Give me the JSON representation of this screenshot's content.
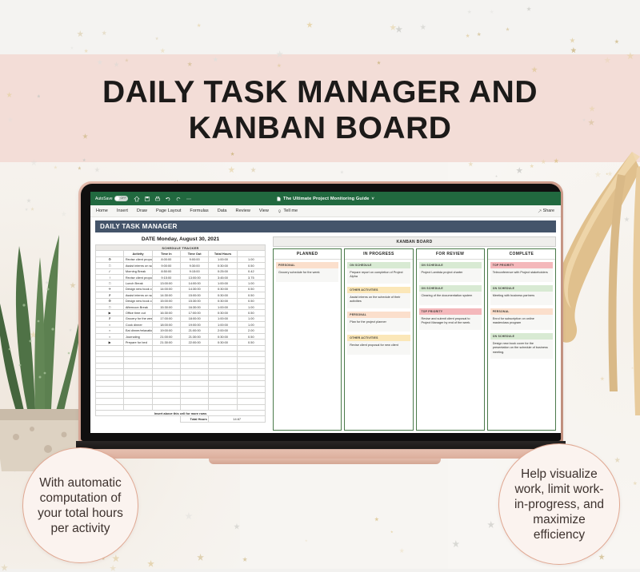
{
  "poster": {
    "title_line1": "DAILY TASK MANAGER AND",
    "title_line2": "KANBAN BOARD",
    "callout_left": "With automatic computation of your total hours per activity",
    "callout_right": "Help visualize work, limit work-in-progress, and maximize efficiency",
    "accent_pink": "#f3ddd7",
    "accent_rose": "#e0a892",
    "excel_green": "#21693f",
    "banner_navy": "#44546a"
  },
  "excel": {
    "autosave_label": "AutoSave",
    "autosave_state": "OFF",
    "document_title": "The Ultimate Project Monitoring Guide",
    "title_chevron": "˅",
    "quick_icons": [
      "home-icon",
      "save-icon",
      "print-icon",
      "undo-icon",
      "redo-icon",
      "more-icon"
    ],
    "ribbon_tabs": [
      "Home",
      "Insert",
      "Draw",
      "Page Layout",
      "Formulas",
      "Data",
      "Review",
      "View"
    ],
    "tell_me": "Tell me",
    "share_label": "Share"
  },
  "sheet": {
    "banner": "DAILY TASK MANAGER",
    "date_label": "DATE",
    "date_value": "Monday, August 30, 2021",
    "tracker_title": "SCHEDULE TRACKER",
    "columns": [
      "",
      "Activity",
      "Time In",
      "Time Out",
      "Total Hours",
      ""
    ],
    "rows": [
      {
        "icon": "⚙",
        "activity": "Revise client proposal for new client",
        "time_in": "8:00:00",
        "time_out": "9:00:00",
        "dur": "1:00:00",
        "hours": "1.00"
      },
      {
        "icon": "□",
        "activity": "Assist interns on schedule of activities",
        "time_in": "9:00:00",
        "time_out": "9:30:00",
        "dur": "0:30:00",
        "hours": "0.50"
      },
      {
        "icon": "✓",
        "activity": "Morning Break",
        "time_in": "8:50:00",
        "time_out": "9:15:00",
        "dur": "0:25:00",
        "hours": "0.42"
      },
      {
        "icon": "!",
        "activity": "Revise client proposal for new client",
        "time_in": "9:15:00",
        "time_out": "13:00:00",
        "dur": "3:45:00",
        "hours": "3.75"
      },
      {
        "icon": "□",
        "activity": "Lunch Break",
        "time_in": "13:00:00",
        "time_out": "14:00:00",
        "dur": "1:00:00",
        "hours": "1.00"
      },
      {
        "icon": "✈",
        "activity": "Design new book cover",
        "time_in": "14:00:00",
        "time_out": "14:30:00",
        "dur": "0:30:00",
        "hours": "0.50"
      },
      {
        "icon": "✗",
        "activity": "Assist interns on schedule of activities",
        "time_in": "14:30:00",
        "time_out": "15:00:00",
        "dur": "0:30:00",
        "hours": "0.50"
      },
      {
        "icon": "⚙",
        "activity": "Design new book cover",
        "time_in": "15:00:00",
        "time_out": "15:30:00",
        "dur": "0:30:00",
        "hours": "0.50"
      },
      {
        "icon": "□",
        "activity": "Afternoon Break",
        "time_in": "15:30:00",
        "time_out": "16:30:00",
        "dur": "1:00:00",
        "hours": "1.00"
      },
      {
        "icon": "▶",
        "activity": "Office time out",
        "time_in": "16:30:00",
        "time_out": "17:00:00",
        "dur": "0:30:00",
        "hours": "0.50"
      },
      {
        "icon": "✗",
        "activity": "Grocery for the week's schedule",
        "time_in": "17:00:00",
        "time_out": "18:00:00",
        "dur": "1:00:00",
        "hours": "1.00"
      },
      {
        "icon": "▪",
        "activity": "Cook dinner",
        "time_in": "18:00:00",
        "time_out": "19:00:00",
        "dur": "1:00:00",
        "hours": "1.00"
      },
      {
        "icon": "▪",
        "activity": "Eat dinner/relaxation/meditation",
        "time_in": "19:00:00",
        "time_out": "21:00:00",
        "dur": "2:00:00",
        "hours": "2.00"
      },
      {
        "icon": "▪",
        "activity": "Journaling",
        "time_in": "21:00:00",
        "time_out": "21:30:00",
        "dur": "0:30:00",
        "hours": "0.50"
      },
      {
        "icon": "▶",
        "activity": "Prepare for bed",
        "time_in": "21:30:00",
        "time_out": "22:00:00",
        "dur": "0:30:00",
        "hours": "0.50"
      }
    ],
    "blank_row_count": 11,
    "insert_note": "Insert above this cell for more rows",
    "total_label": "Total Hours",
    "total_value": "14.67"
  },
  "kanban": {
    "title": "KANBAN BOARD",
    "columns": [
      {
        "name": "PLANNED",
        "cards": [
          {
            "tag": "PERSONAL",
            "tag_style": "tag-personal",
            "text": "Grocery schedule for the week"
          }
        ]
      },
      {
        "name": "IN PROGRESS",
        "cards": [
          {
            "tag": "ON SCHEDULE",
            "tag_style": "tag-onsched",
            "text": "Prepare report on completion of Project Alpha"
          },
          {
            "tag": "OTHER ACTIVITIES",
            "tag_style": "tag-other",
            "text": "Assist interns on the schedule of their activities"
          },
          {
            "tag": "PERSONAL",
            "tag_style": "tag-personal",
            "text": "Plan for the project planner"
          },
          {
            "tag": "OTHER ACTIVITIES",
            "tag_style": "tag-other",
            "text": "Revise client proposal for new client"
          }
        ]
      },
      {
        "name": "FOR REVIEW",
        "cards": [
          {
            "tag": "ON SCHEDULE",
            "tag_style": "tag-onsched",
            "text": "Project Lambda project charter"
          },
          {
            "tag": "ON SCHEDULE",
            "tag_style": "tag-onsched",
            "text": "Clearing of the documentation system"
          },
          {
            "tag": "TOP PRIORITY",
            "tag_style": "tag-top",
            "text": "Revise and submit client proposal to Project Manager by end of the week."
          }
        ]
      },
      {
        "name": "COMPLETE",
        "cards": [
          {
            "tag": "TOP PRIORITY",
            "tag_style": "tag-top",
            "text": "Teleconference with Project stakeholders"
          },
          {
            "tag": "ON SCHEDULE",
            "tag_style": "tag-onsched",
            "text": "Meeting with business partners"
          },
          {
            "tag": "PERSONAL",
            "tag_style": "tag-personal",
            "text": "Enrol for subscription on online masterclass program"
          },
          {
            "tag": "ON SCHEDULE",
            "tag_style": "tag-onsched",
            "text": "Design new book cover for the presentation on the schedule of business meeting."
          }
        ]
      }
    ]
  }
}
